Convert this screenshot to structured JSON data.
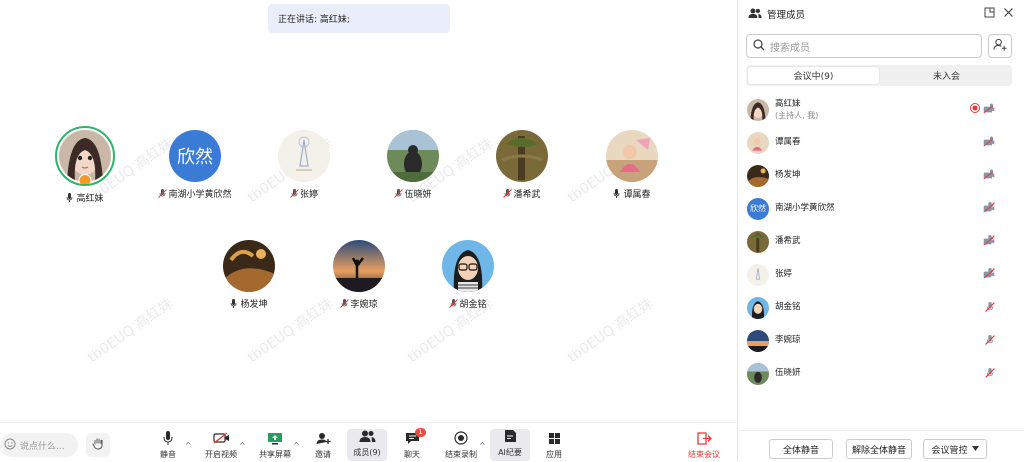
{
  "speaking": {
    "text": "正在讲话: 高红妹;"
  },
  "watermark": "tb0EUQ 高红妹",
  "participants": [
    {
      "name": "高红妹",
      "avatar": "photo-girl",
      "mic": "on",
      "host": true
    },
    {
      "name": "南湖小学黄欣然",
      "avatar_text": "欣然",
      "mic": "muted"
    },
    {
      "name": "张婷",
      "avatar": "photo-sketch",
      "mic": "muted"
    },
    {
      "name": "伍晓妍",
      "avatar": "photo-outdoor",
      "mic": "muted"
    },
    {
      "name": "潘希武",
      "avatar": "photo-tree",
      "mic": "muted"
    },
    {
      "name": "谭属春",
      "avatar": "photo-child",
      "mic": "on"
    },
    {
      "name": "杨发坤",
      "avatar": "photo-landscape",
      "mic": "on"
    },
    {
      "name": "李婉琼",
      "avatar": "photo-sunset",
      "mic": "muted"
    },
    {
      "name": "胡金铭",
      "avatar": "cartoon-girl",
      "mic": "muted"
    }
  ],
  "toolbar": {
    "say_placeholder": "说点什么...",
    "mute": "静音",
    "video": "开启视频",
    "share": "共享屏幕",
    "invite": "邀请",
    "members": "成员(9)",
    "chat": "聊天",
    "chat_badge": "1",
    "record": "结束录制",
    "ai": "AI纪要",
    "apps": "应用",
    "end": "结束会议"
  },
  "panel": {
    "title": "管理成员",
    "search_placeholder": "搜索成员",
    "tab_in": "会议中(9)",
    "tab_out": "未入会",
    "members": [
      {
        "name": "高红妹",
        "sub": "(主持人, 我)",
        "avatar": "photo-girl",
        "recording": true,
        "mic": "on",
        "cam": "off"
      },
      {
        "name": "谭属春",
        "avatar": "photo-child",
        "mic": "on",
        "cam": "off"
      },
      {
        "name": "杨发坤",
        "avatar": "photo-landscape",
        "mic": "on",
        "cam": "off"
      },
      {
        "name": "南湖小学黄欣然",
        "avatar_text": "欣然",
        "mic": "muted",
        "cam": "off"
      },
      {
        "name": "潘希武",
        "avatar": "photo-tree",
        "mic": "muted",
        "cam": "off"
      },
      {
        "name": "张婷",
        "avatar": "photo-sketch",
        "mic": "muted",
        "cam": "off"
      },
      {
        "name": "胡金铭",
        "avatar": "cartoon-girl",
        "mic": "muted"
      },
      {
        "name": "李婉琼",
        "avatar": "photo-sunset",
        "mic": "muted"
      },
      {
        "name": "伍晓妍",
        "avatar": "photo-outdoor",
        "mic": "muted"
      }
    ],
    "mute_all": "全体静音",
    "unmute_all": "解除全体静音",
    "control": "会议管控"
  },
  "colors": {
    "accent": "#2db56a",
    "end": "#e53935",
    "badge": "#e84c3d",
    "text_avatar": "#3a7bd5"
  }
}
